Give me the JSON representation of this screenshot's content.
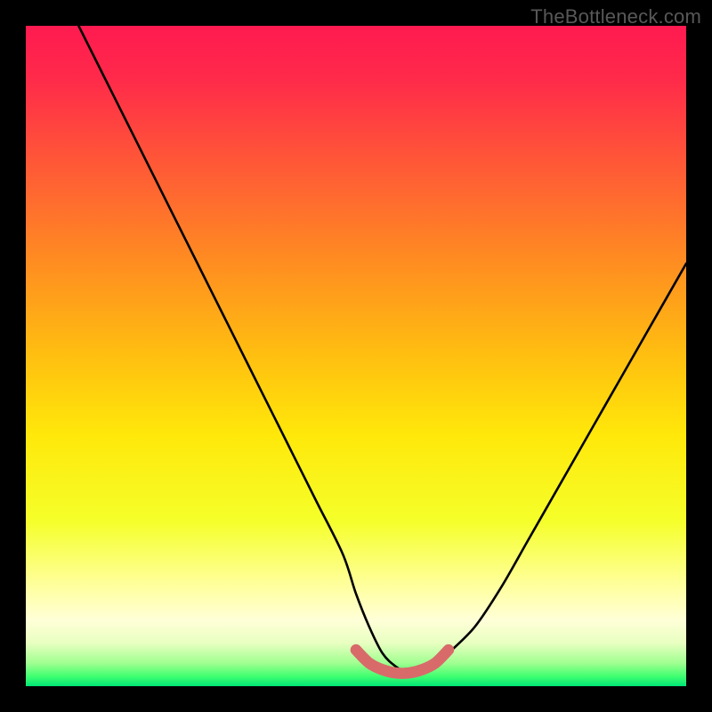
{
  "watermark": "TheBottleneck.com",
  "colors": {
    "frame": "#000000",
    "gradient_stops": [
      {
        "pos": 0.0,
        "color": "#ff1a50"
      },
      {
        "pos": 0.08,
        "color": "#ff2a4a"
      },
      {
        "pos": 0.2,
        "color": "#ff5538"
      },
      {
        "pos": 0.35,
        "color": "#ff8a22"
      },
      {
        "pos": 0.5,
        "color": "#ffbf10"
      },
      {
        "pos": 0.62,
        "color": "#ffe80a"
      },
      {
        "pos": 0.75,
        "color": "#f5ff2a"
      },
      {
        "pos": 0.85,
        "color": "#ffffa0"
      },
      {
        "pos": 0.9,
        "color": "#ffffd8"
      },
      {
        "pos": 0.935,
        "color": "#e8ffc0"
      },
      {
        "pos": 0.965,
        "color": "#a0ff90"
      },
      {
        "pos": 0.985,
        "color": "#40ff70"
      },
      {
        "pos": 1.0,
        "color": "#00e676"
      }
    ],
    "curve": "#000000",
    "highlight": "#d96a6a"
  },
  "chart_data": {
    "type": "line",
    "title": "",
    "xlabel": "",
    "ylabel": "",
    "xlim": [
      0,
      100
    ],
    "ylim": [
      0,
      100
    ],
    "series": [
      {
        "name": "bottleneck-curve",
        "x": [
          8,
          12,
          16,
          20,
          24,
          28,
          32,
          36,
          40,
          44,
          48,
          50,
          52,
          54,
          56,
          58,
          60,
          62,
          64,
          68,
          72,
          76,
          80,
          84,
          88,
          92,
          96,
          100
        ],
        "y": [
          100,
          92,
          84,
          76,
          68,
          60,
          52,
          44,
          36,
          28,
          20,
          14,
          9,
          5,
          3,
          2,
          2,
          3,
          5,
          9,
          15,
          22,
          29,
          36,
          43,
          50,
          57,
          64
        ]
      },
      {
        "name": "optimal-range-highlight",
        "x": [
          50,
          52,
          54,
          56,
          58,
          60,
          62,
          64
        ],
        "y": [
          5.5,
          3.5,
          2.5,
          2,
          2,
          2.5,
          3.5,
          5.5
        ]
      }
    ],
    "annotations": [
      {
        "text": "TheBottleneck.com",
        "position": "top-right"
      }
    ]
  }
}
